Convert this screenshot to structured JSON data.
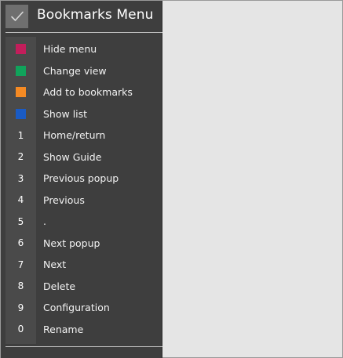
{
  "menu": {
    "title": "Bookmarks  Menu",
    "header_icon": "checkmark-icon",
    "items": [
      {
        "key": "",
        "swatch": "#c21e5b",
        "label": "Hide menu"
      },
      {
        "key": "",
        "swatch": "#10a35b",
        "label": "Change view"
      },
      {
        "key": "",
        "swatch": "#f58a23",
        "label": "Add to bookmarks"
      },
      {
        "key": "",
        "swatch": "#1a5bc4",
        "label": "Show list"
      },
      {
        "key": "1",
        "swatch": "",
        "label": "Home/return"
      },
      {
        "key": "2",
        "swatch": "",
        "label": "Show Guide"
      },
      {
        "key": "3",
        "swatch": "",
        "label": "Previous popup"
      },
      {
        "key": "4",
        "swatch": "",
        "label": "Previous"
      },
      {
        "key": "5",
        "swatch": "",
        "label": "."
      },
      {
        "key": "6",
        "swatch": "",
        "label": "Next popup"
      },
      {
        "key": "7",
        "swatch": "",
        "label": "Next"
      },
      {
        "key": "8",
        "swatch": "",
        "label": "Delete"
      },
      {
        "key": "9",
        "swatch": "",
        "label": "Configuration"
      },
      {
        "key": "0",
        "swatch": "",
        "label": "Rename"
      }
    ]
  },
  "colors": {
    "menu_background": "#3e3e3e",
    "key_column": "#4a4a4a",
    "content_background": "#e5e5e5"
  }
}
